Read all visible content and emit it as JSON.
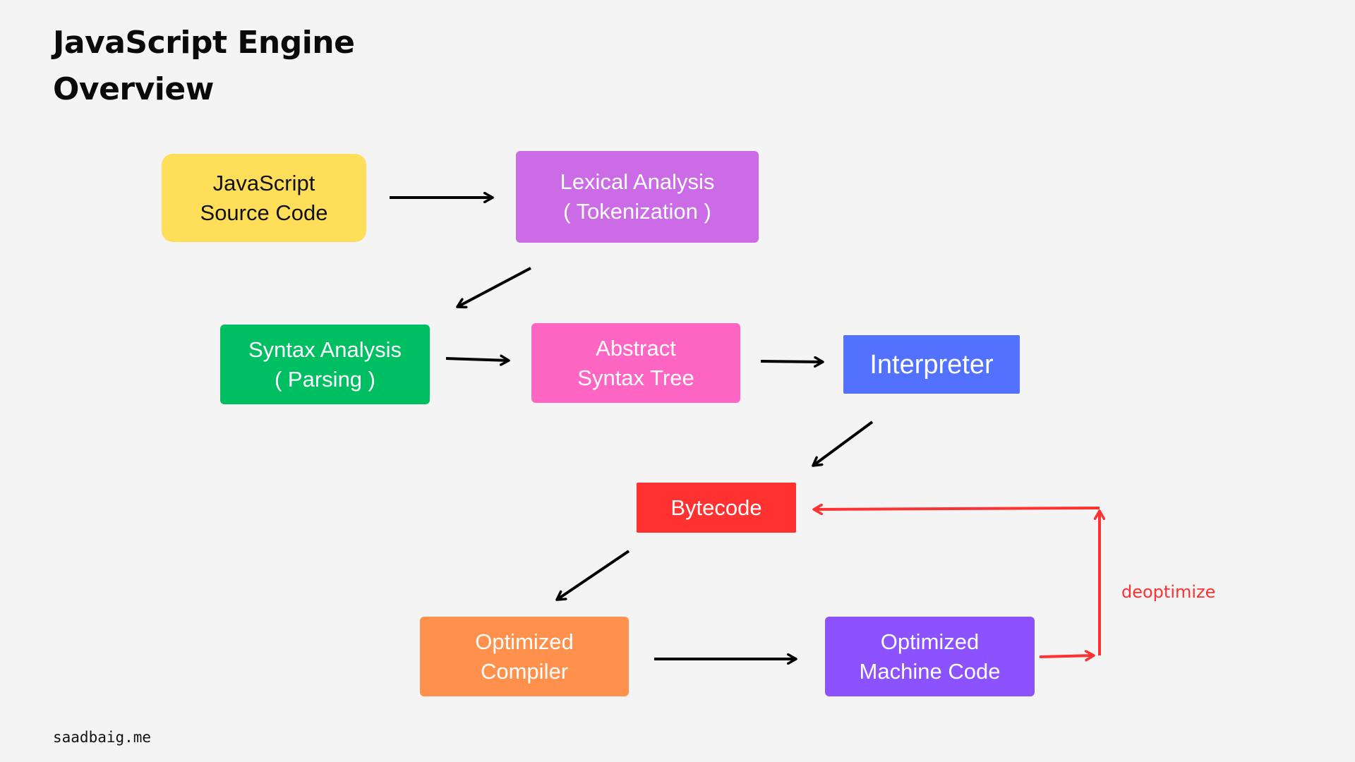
{
  "title": {
    "line1": "JavaScript Engine",
    "line2": "Overview"
  },
  "nodes": {
    "source": {
      "line1": "JavaScript",
      "line2": "Source Code",
      "color": "#ffde59"
    },
    "lexical": {
      "line1": "Lexical Analysis",
      "line2": "( Tokenization )",
      "color": "#cb6ce6"
    },
    "syntax": {
      "line1": "Syntax Analysis",
      "line2": "( Parsing )",
      "color": "#00bf63"
    },
    "ast": {
      "line1": "Abstract",
      "line2": "Syntax Tree",
      "color": "#ff66c4"
    },
    "interpreter": {
      "label": "Interpreter",
      "color": "#5271ff"
    },
    "bytecode": {
      "label": "Bytecode",
      "color": "#ff3131"
    },
    "optimized_compiler": {
      "line1": "Optimized",
      "line2": "Compiler",
      "color": "#ff914d"
    },
    "optimized_machine_code": {
      "line1": "Optimized",
      "line2": "Machine Code",
      "color": "#8c52ff"
    }
  },
  "edges": [
    {
      "from": "source",
      "to": "lexical"
    },
    {
      "from": "lexical",
      "to": "syntax"
    },
    {
      "from": "syntax",
      "to": "ast"
    },
    {
      "from": "ast",
      "to": "interpreter"
    },
    {
      "from": "interpreter",
      "to": "bytecode"
    },
    {
      "from": "bytecode",
      "to": "optimized_compiler"
    },
    {
      "from": "optimized_compiler",
      "to": "optimized_machine_code"
    },
    {
      "from": "optimized_machine_code",
      "to": "bytecode",
      "label": "deoptimize",
      "color": "#ff3131"
    }
  ],
  "deoptimize_label": "deoptimize",
  "footer": "saadbaig.me"
}
